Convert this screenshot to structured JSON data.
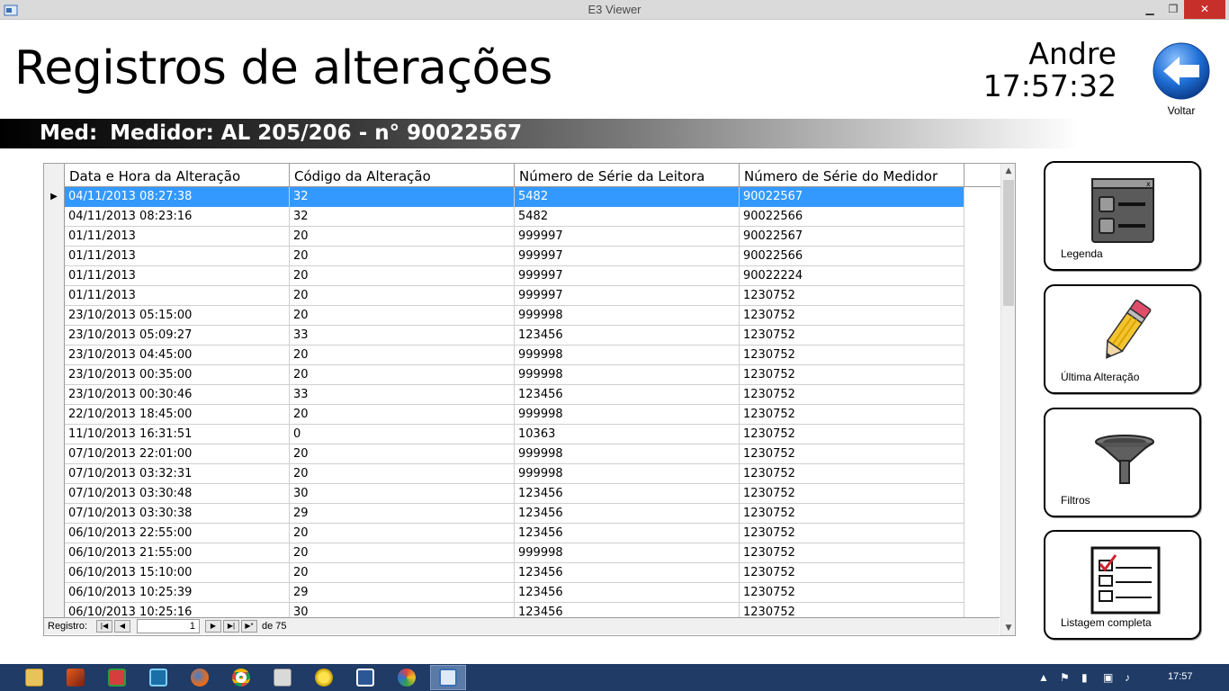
{
  "window": {
    "title": "E3 Viewer",
    "minimize": "▁",
    "maximize": "❐",
    "close": "✕"
  },
  "header": {
    "page_title": "Registros de alterações",
    "user": "Andre",
    "time": "17:57:32",
    "back_label": "Voltar"
  },
  "banner": {
    "prefix": "Med:",
    "text": "Medidor: AL 205/206 - n° 90022567"
  },
  "grid": {
    "columns": [
      "Data e Hora da Alteração",
      "Código da Alteração",
      "Número de Série da Leitora",
      "Número de Série do Medidor"
    ],
    "selected_marker": "▶",
    "rows": [
      [
        "04/11/2013 08:27:38",
        "32",
        "5482",
        "90022567"
      ],
      [
        "04/11/2013 08:23:16",
        "32",
        "5482",
        "90022566"
      ],
      [
        "01/11/2013",
        "20",
        "999997",
        "90022567"
      ],
      [
        "01/11/2013",
        "20",
        "999997",
        "90022566"
      ],
      [
        "01/11/2013",
        "20",
        "999997",
        "90022224"
      ],
      [
        "01/11/2013",
        "20",
        "999997",
        "1230752"
      ],
      [
        "23/10/2013 05:15:00",
        "20",
        "999998",
        "1230752"
      ],
      [
        "23/10/2013 05:09:27",
        "33",
        "123456",
        "1230752"
      ],
      [
        "23/10/2013 04:45:00",
        "20",
        "999998",
        "1230752"
      ],
      [
        "23/10/2013 00:35:00",
        "20",
        "999998",
        "1230752"
      ],
      [
        "23/10/2013 00:30:46",
        "33",
        "123456",
        "1230752"
      ],
      [
        "22/10/2013 18:45:00",
        "20",
        "999998",
        "1230752"
      ],
      [
        "11/10/2013 16:31:51",
        "0",
        "10363",
        "1230752"
      ],
      [
        "07/10/2013 22:01:00",
        "20",
        "999998",
        "1230752"
      ],
      [
        "07/10/2013 03:32:31",
        "20",
        "999998",
        "1230752"
      ],
      [
        "07/10/2013 03:30:48",
        "30",
        "123456",
        "1230752"
      ],
      [
        "07/10/2013 03:30:38",
        "29",
        "123456",
        "1230752"
      ],
      [
        "06/10/2013 22:55:00",
        "20",
        "123456",
        "1230752"
      ],
      [
        "06/10/2013 21:55:00",
        "20",
        "999998",
        "1230752"
      ],
      [
        "06/10/2013 15:10:00",
        "20",
        "123456",
        "1230752"
      ],
      [
        "06/10/2013 10:25:39",
        "29",
        "123456",
        "1230752"
      ],
      [
        "06/10/2013 10:25:16",
        "30",
        "123456",
        "1230752"
      ]
    ],
    "selected_row": 0
  },
  "navigator": {
    "label": "Registro:",
    "current": "1",
    "total": "de 75",
    "first": "|◀",
    "prev": "◀",
    "next": "▶",
    "last": "▶|",
    "new": "▶*"
  },
  "side_buttons": [
    {
      "label": "Legenda",
      "icon": "legend-window-icon"
    },
    {
      "label": "Última Alteração",
      "icon": "pencil-icon"
    },
    {
      "label": "Filtros",
      "icon": "funnel-filter-icon"
    },
    {
      "label": "Listagem completa",
      "icon": "checklist-icon"
    }
  ],
  "taskbar": {
    "clock": "17:57",
    "items": [
      "file-explorer",
      "matlab",
      "app-window",
      "terminal",
      "firefox",
      "chrome",
      "tools",
      "sun-app",
      "word",
      "paint",
      "e3-viewer"
    ],
    "active": "e3-viewer"
  },
  "colors": {
    "selection": "#3399ff",
    "taskbar": "#1f3b66",
    "close_button": "#c7302a",
    "back_arrow": "#1f6fd6"
  }
}
